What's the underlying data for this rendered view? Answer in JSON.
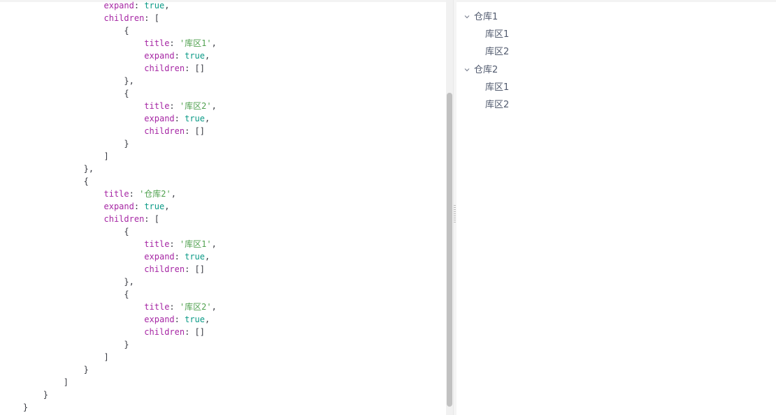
{
  "code": {
    "lines": [
      {
        "indent": "                    ",
        "parts": [
          {
            "t": "expand",
            "c": "k"
          },
          {
            "t": ": ",
            "c": "p"
          },
          {
            "t": "true",
            "c": "b"
          },
          {
            "t": ",",
            "c": "p"
          }
        ]
      },
      {
        "indent": "                    ",
        "parts": [
          {
            "t": "children",
            "c": "k"
          },
          {
            "t": ": [",
            "c": "p"
          }
        ]
      },
      {
        "indent": "                        ",
        "parts": [
          {
            "t": "{",
            "c": "p"
          }
        ]
      },
      {
        "indent": "                            ",
        "parts": [
          {
            "t": "title",
            "c": "k"
          },
          {
            "t": ": ",
            "c": "p"
          },
          {
            "t": "'库区1'",
            "c": "s"
          },
          {
            "t": ",",
            "c": "p"
          }
        ]
      },
      {
        "indent": "                            ",
        "parts": [
          {
            "t": "expand",
            "c": "k"
          },
          {
            "t": ": ",
            "c": "p"
          },
          {
            "t": "true",
            "c": "b"
          },
          {
            "t": ",",
            "c": "p"
          }
        ]
      },
      {
        "indent": "                            ",
        "parts": [
          {
            "t": "children",
            "c": "k"
          },
          {
            "t": ": []",
            "c": "p"
          }
        ]
      },
      {
        "indent": "                        ",
        "parts": [
          {
            "t": "},",
            "c": "p"
          }
        ]
      },
      {
        "indent": "                        ",
        "parts": [
          {
            "t": "{",
            "c": "p"
          }
        ]
      },
      {
        "indent": "                            ",
        "parts": [
          {
            "t": "title",
            "c": "k"
          },
          {
            "t": ": ",
            "c": "p"
          },
          {
            "t": "'库区2'",
            "c": "s"
          },
          {
            "t": ",",
            "c": "p"
          }
        ]
      },
      {
        "indent": "                            ",
        "parts": [
          {
            "t": "expand",
            "c": "k"
          },
          {
            "t": ": ",
            "c": "p"
          },
          {
            "t": "true",
            "c": "b"
          },
          {
            "t": ",",
            "c": "p"
          }
        ]
      },
      {
        "indent": "                            ",
        "parts": [
          {
            "t": "children",
            "c": "k"
          },
          {
            "t": ": []",
            "c": "p"
          }
        ]
      },
      {
        "indent": "                        ",
        "parts": [
          {
            "t": "}",
            "c": "p"
          }
        ]
      },
      {
        "indent": "                    ",
        "parts": [
          {
            "t": "]",
            "c": "p"
          }
        ]
      },
      {
        "indent": "                ",
        "parts": [
          {
            "t": "},",
            "c": "p"
          }
        ]
      },
      {
        "indent": "                ",
        "parts": [
          {
            "t": "{",
            "c": "p"
          }
        ]
      },
      {
        "indent": "                    ",
        "parts": [
          {
            "t": "title",
            "c": "k"
          },
          {
            "t": ": ",
            "c": "p"
          },
          {
            "t": "'仓库2'",
            "c": "s"
          },
          {
            "t": ",",
            "c": "p"
          }
        ]
      },
      {
        "indent": "                    ",
        "parts": [
          {
            "t": "expand",
            "c": "k"
          },
          {
            "t": ": ",
            "c": "p"
          },
          {
            "t": "true",
            "c": "b"
          },
          {
            "t": ",",
            "c": "p"
          }
        ]
      },
      {
        "indent": "                    ",
        "parts": [
          {
            "t": "children",
            "c": "k"
          },
          {
            "t": ": [",
            "c": "p"
          }
        ]
      },
      {
        "indent": "                        ",
        "parts": [
          {
            "t": "{",
            "c": "p"
          }
        ]
      },
      {
        "indent": "                            ",
        "parts": [
          {
            "t": "title",
            "c": "k"
          },
          {
            "t": ": ",
            "c": "p"
          },
          {
            "t": "'库区1'",
            "c": "s"
          },
          {
            "t": ",",
            "c": "p"
          }
        ]
      },
      {
        "indent": "                            ",
        "parts": [
          {
            "t": "expand",
            "c": "k"
          },
          {
            "t": ": ",
            "c": "p"
          },
          {
            "t": "true",
            "c": "b"
          },
          {
            "t": ",",
            "c": "p"
          }
        ]
      },
      {
        "indent": "                            ",
        "parts": [
          {
            "t": "children",
            "c": "k"
          },
          {
            "t": ": []",
            "c": "p"
          }
        ]
      },
      {
        "indent": "                        ",
        "parts": [
          {
            "t": "},",
            "c": "p"
          }
        ]
      },
      {
        "indent": "                        ",
        "parts": [
          {
            "t": "{",
            "c": "p"
          }
        ]
      },
      {
        "indent": "                            ",
        "parts": [
          {
            "t": "title",
            "c": "k"
          },
          {
            "t": ": ",
            "c": "p"
          },
          {
            "t": "'库区2'",
            "c": "s"
          },
          {
            "t": ",",
            "c": "p"
          }
        ]
      },
      {
        "indent": "                            ",
        "parts": [
          {
            "t": "expand",
            "c": "k"
          },
          {
            "t": ": ",
            "c": "p"
          },
          {
            "t": "true",
            "c": "b"
          },
          {
            "t": ",",
            "c": "p"
          }
        ]
      },
      {
        "indent": "                            ",
        "parts": [
          {
            "t": "children",
            "c": "k"
          },
          {
            "t": ": []",
            "c": "p"
          }
        ]
      },
      {
        "indent": "                        ",
        "parts": [
          {
            "t": "}",
            "c": "p"
          }
        ]
      },
      {
        "indent": "                    ",
        "parts": [
          {
            "t": "]",
            "c": "p"
          }
        ]
      },
      {
        "indent": "                ",
        "parts": [
          {
            "t": "}",
            "c": "p"
          }
        ]
      },
      {
        "indent": "            ",
        "parts": [
          {
            "t": "]",
            "c": "p"
          }
        ]
      },
      {
        "indent": "        ",
        "parts": [
          {
            "t": "}",
            "c": "p"
          }
        ]
      },
      {
        "indent": "    ",
        "parts": [
          {
            "t": "}",
            "c": "p"
          }
        ]
      }
    ]
  },
  "tree": {
    "nodes": [
      {
        "label": "仓库1",
        "level": 0,
        "expanded": true
      },
      {
        "label": "库区1",
        "level": 1
      },
      {
        "label": "库区2",
        "level": 1
      },
      {
        "label": "仓库2",
        "level": 0,
        "expanded": true
      },
      {
        "label": "库区1",
        "level": 1
      },
      {
        "label": "库区2",
        "level": 1
      }
    ]
  },
  "colors": {
    "keyword": "#a626a4",
    "string": "#50a14f",
    "boolean": "#0a9a86",
    "punctuation": "#383a42",
    "tree_text": "#515a6e"
  }
}
